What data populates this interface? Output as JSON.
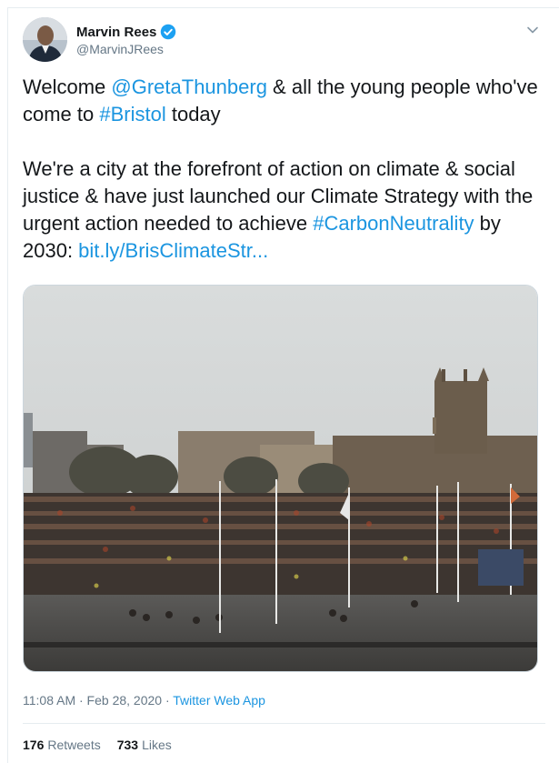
{
  "tweet": {
    "author": {
      "name": "Marvin Rees",
      "handle": "@MarvinJRees",
      "verified": true
    },
    "text": {
      "p1": {
        "welcome": "Welcome ",
        "mention": "@GretaThunberg",
        "mid": " & all the young people who've come to ",
        "hashtag_bristol": "#Bristol",
        "end": " today"
      },
      "p2": {
        "body": "We're a city at the forefront of action on climate & social justice & have just launched our Climate Strategy with the urgent action needed to achieve ",
        "hashtag_carbon": "#CarbonNeutrality",
        "by": " by 2030: ",
        "link": "bit.ly/BrisClimateStr..."
      }
    },
    "timestamp": "11:08 AM · Feb 28, 2020",
    "separator": " · ",
    "source_app": "Twitter Web App",
    "stats": {
      "retweets_count": "176",
      "retweets_label": "Retweets",
      "likes_count": "733",
      "likes_label": "Likes"
    }
  },
  "icons": {
    "verified": "verified-badge-icon",
    "caret": "chevron-down-icon"
  },
  "colors": {
    "link": "#1b95e0",
    "secondary_text": "#657786",
    "primary_text": "#14171a",
    "verified_blue": "#1da1f2"
  }
}
